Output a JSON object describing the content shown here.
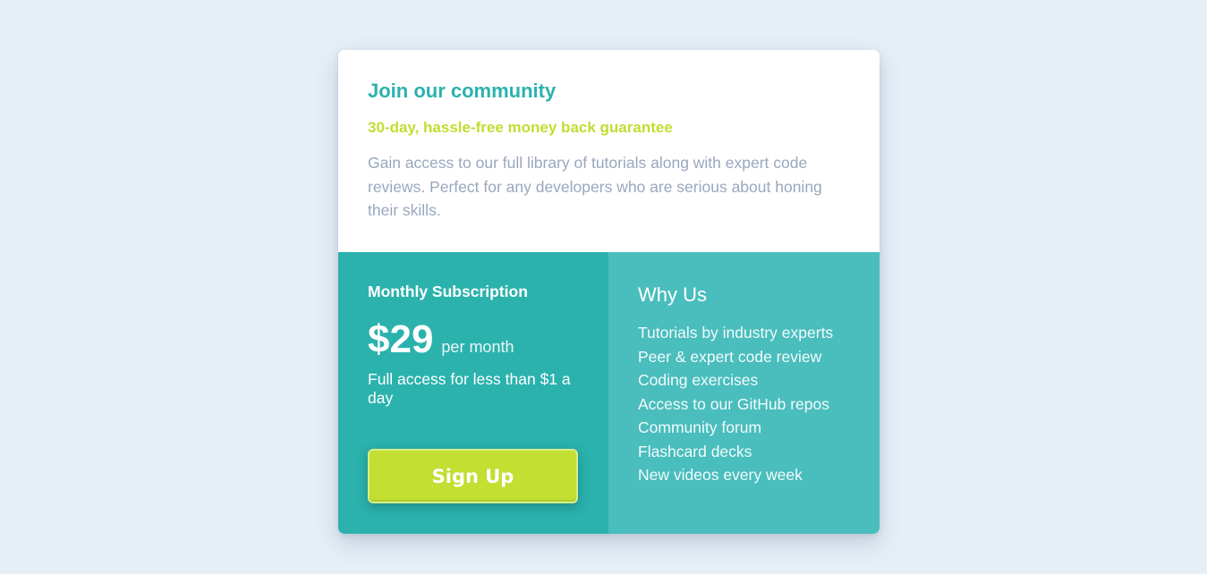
{
  "header": {
    "title": "Join our community",
    "subtitle": "30-day, hassle-free money back guarantee",
    "description": "Gain access to our full library of tutorials along with expert code reviews. Perfect for any developers who are serious about honing their skills."
  },
  "subscription": {
    "plan_name": "Monthly Subscription",
    "price": "$29",
    "period": "per month",
    "note": "Full access for less than $1 a day",
    "signup_label": "Sign Up"
  },
  "why_us": {
    "title": "Why Us",
    "features": [
      "Tutorials by industry experts",
      "Peer & expert code review",
      "Coding exercises",
      "Access to our GitHub repos",
      "Community forum",
      "Flashcard decks",
      "New videos every week"
    ]
  },
  "colors": {
    "page_background": "#e6eef6",
    "primary_teal": "#2bb2ad",
    "secondary_teal": "#4abdbd",
    "accent_lime": "#c2df32",
    "muted_text": "#9aa7bd"
  }
}
